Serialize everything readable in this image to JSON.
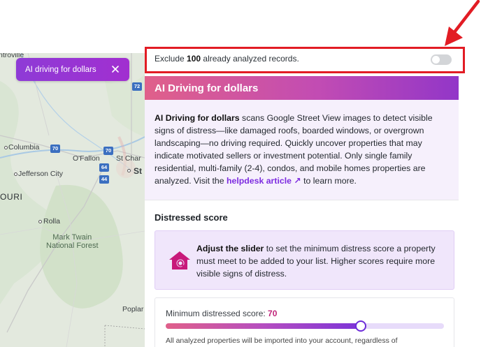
{
  "map": {
    "labels": {
      "top_town": "ntroville",
      "columbia": "Columbia",
      "ofallon": "O'Fallon",
      "st_charles": "St Char",
      "st_louis": "St",
      "jefferson_city": "Jefferson City",
      "state": "OURI",
      "rolla": "Rolla",
      "forest_line1": "Mark Twain",
      "forest_line2": "National Forest",
      "poplar": "Poplar"
    },
    "shields": {
      "i72": "72",
      "i70_west": "70",
      "i70_east": "70",
      "i64": "64",
      "i44": "44"
    }
  },
  "chip": {
    "label": "AI driving for dollars"
  },
  "exclude": {
    "prefix": "Exclude ",
    "count": "100",
    "suffix": " already analyzed records.",
    "toggle_on": false
  },
  "section": {
    "title": "AI Driving for dollars"
  },
  "description": {
    "lead": "AI Driving for dollars",
    "body": " scans Google Street View images to detect visible signs of distress—like damaged roofs, boarded windows, or overgrown landscaping—no driving required. Quickly uncover properties that may indicate motivated sellers or investment potential. Only single family residential, multi-family (2-4), condos, and mobile homes properties are analyzed. Visit the ",
    "link": "helpdesk article ↗",
    "tail": " to learn more."
  },
  "distressed": {
    "title": "Distressed score",
    "info_lead": "Adjust the slider",
    "info_body": " to set the minimum distress score a property must meet to be added to your list. Higher scores require more visible signs of distress.",
    "slider_label": "Minimum distressed score: ",
    "slider_value": "70",
    "slider_fraction": 0.7,
    "note": "All analyzed properties will be imported into your account, regardless of"
  },
  "colors": {
    "accent_purple": "#7d2ce0",
    "highlight_red": "#e21c24",
    "score_value": "#c0257a"
  },
  "icons": {
    "chip_close": "close-icon",
    "info": "house-search-icon",
    "annotation": "red-arrow-icon"
  }
}
